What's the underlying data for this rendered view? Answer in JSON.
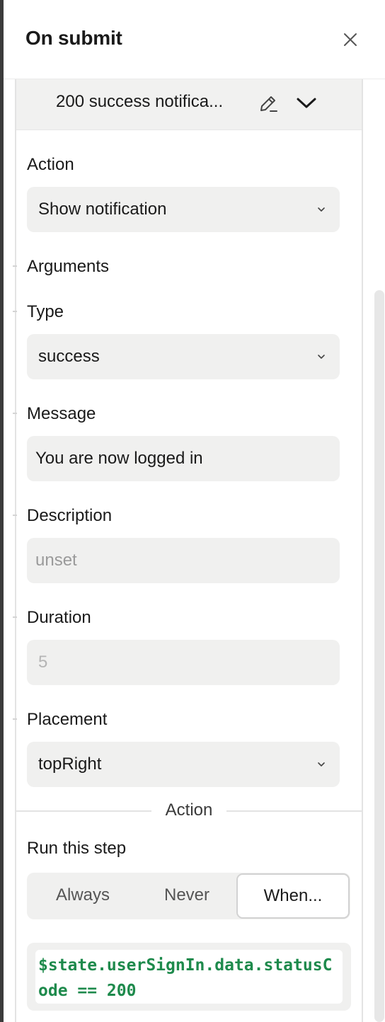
{
  "panel": {
    "title": "On submit"
  },
  "step": {
    "title": "200 success notifica...",
    "action_label": "Action",
    "action_value": "Show notification",
    "arguments_label": "Arguments",
    "type_label": "Type",
    "type_value": "success",
    "message_label": "Message",
    "message_value": "You are now logged in",
    "description_label": "Description",
    "description_placeholder": "unset",
    "duration_label": "Duration",
    "duration_placeholder": "5",
    "placement_label": "Placement",
    "placement_value": "topRight"
  },
  "condition": {
    "divider": "Action",
    "run_label": "Run this step",
    "options": [
      "Always",
      "Never",
      "When..."
    ],
    "selected": "When...",
    "expression": "$state.userSignIn.data.statusCode == 200"
  },
  "icons": {
    "close": "close-icon",
    "edit": "pencil-icon",
    "collapse": "chevron-down-icon",
    "dropdown": "chevron-down-icon"
  },
  "colors": {
    "code_text": "#1e8a4c",
    "field_bg": "#f0f0ef"
  }
}
